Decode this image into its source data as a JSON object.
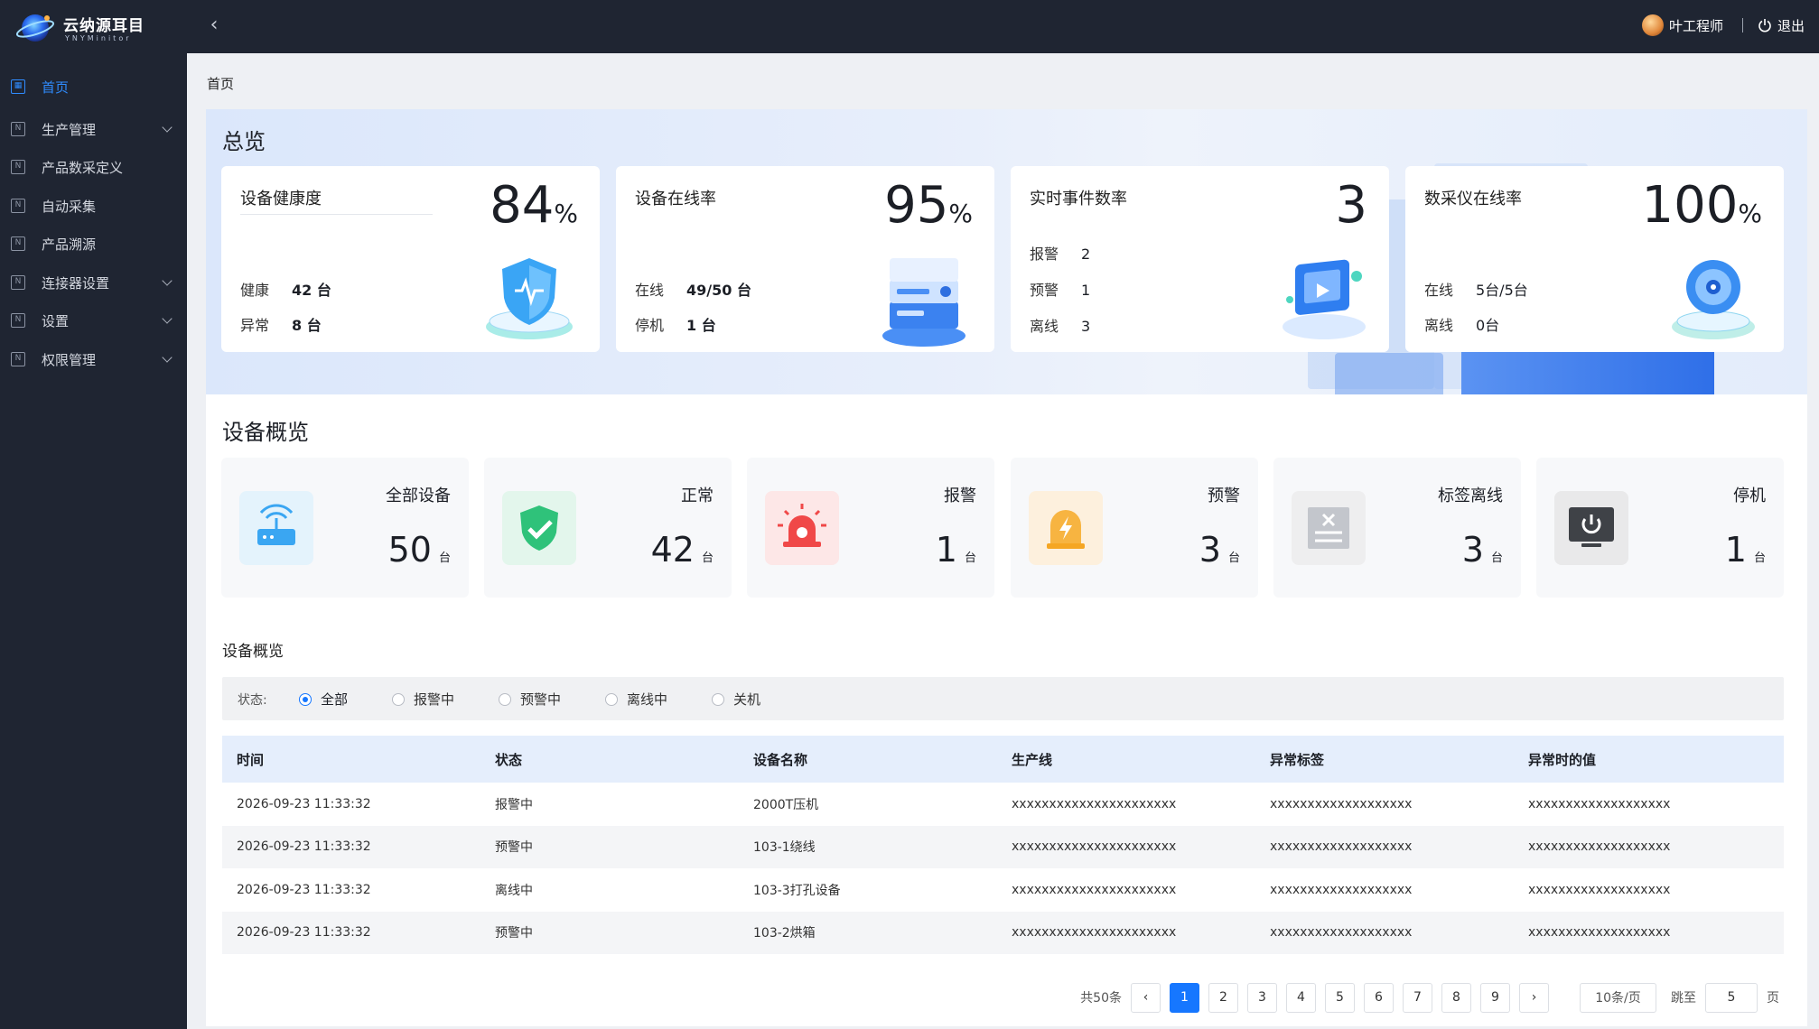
{
  "app": {
    "title": "云纳源耳目",
    "subtitle": "YNYMinitor"
  },
  "header": {
    "user_name": "叶工程师",
    "logout_label": "退出"
  },
  "sidebar": {
    "items": [
      {
        "label": "首页",
        "active": true,
        "has_children": false
      },
      {
        "label": "生产管理",
        "active": false,
        "has_children": true
      },
      {
        "label": "产品数采定义",
        "active": false,
        "has_children": false
      },
      {
        "label": "自动采集",
        "active": false,
        "has_children": false
      },
      {
        "label": "产品溯源",
        "active": false,
        "has_children": false
      },
      {
        "label": "连接器设置",
        "active": false,
        "has_children": true
      },
      {
        "label": "设置",
        "active": false,
        "has_children": true
      },
      {
        "label": "权限管理",
        "active": false,
        "has_children": true
      }
    ]
  },
  "breadcrumb": "首页",
  "overview": {
    "title": "总览",
    "cards": [
      {
        "title": "设备健康度",
        "value": "84",
        "unit": "%",
        "rows": [
          {
            "k": "健康",
            "v": "42 台"
          },
          {
            "k": "异常",
            "v": "8 台"
          }
        ],
        "icon": "shield-icon"
      },
      {
        "title": "设备在线率",
        "value": "95",
        "unit": "%",
        "rows": [
          {
            "k": "在线",
            "v": "49/50 台"
          },
          {
            "k": "停机",
            "v": "1 台"
          }
        ],
        "icon": "server-icon"
      },
      {
        "title": "实时事件数率",
        "value": "3",
        "unit": "",
        "rows": [
          {
            "k": "报警",
            "v": "2"
          },
          {
            "k": "预警",
            "v": "1"
          },
          {
            "k": "离线",
            "v": "3"
          }
        ],
        "icon": "video-icon"
      },
      {
        "title": "数采仪在线率",
        "value": "100",
        "unit": "%",
        "rows": [
          {
            "k": "在线",
            "v": "5台/5台"
          },
          {
            "k": "离线",
            "v": "0台"
          }
        ],
        "icon": "disc-icon"
      }
    ]
  },
  "device_overview": {
    "title": "设备概览",
    "cards": [
      {
        "label": "全部设备",
        "value": "50",
        "unit": "台",
        "icon": "router-icon"
      },
      {
        "label": "正常",
        "value": "42",
        "unit": "台",
        "icon": "check-shield-icon"
      },
      {
        "label": "报警",
        "value": "1",
        "unit": "台",
        "icon": "siren-icon"
      },
      {
        "label": "预警",
        "value": "3",
        "unit": "台",
        "icon": "warning-lamp-icon"
      },
      {
        "label": "标签离线",
        "value": "3",
        "unit": "台",
        "icon": "tag-offline-icon"
      },
      {
        "label": "停机",
        "value": "1",
        "unit": "台",
        "icon": "power-icon"
      }
    ]
  },
  "table_section": {
    "title": "设备概览",
    "filter_label": "状态:",
    "filters": [
      "全部",
      "报警中",
      "预警中",
      "离线中",
      "关机"
    ],
    "selected_filter": "全部",
    "columns": [
      "时间",
      "状态",
      "设备名称",
      "生产线",
      "异常标签",
      "异常时的值"
    ],
    "rows": [
      {
        "time": "2026-09-23  11:33:32",
        "status": "报警中",
        "status_type": "alarm",
        "device": "2000T压机",
        "line": "xxxxxxxxxxxxxxxxxxxxxx",
        "tag": "xxxxxxxxxxxxxxxxxxx",
        "value": "xxxxxxxxxxxxxxxxxxx"
      },
      {
        "time": "2026-09-23  11:33:32",
        "status": "预警中",
        "status_type": "warn",
        "device": "103-1绕线",
        "line": "xxxxxxxxxxxxxxxxxxxxxx",
        "tag": "xxxxxxxxxxxxxxxxxxx",
        "value": "xxxxxxxxxxxxxxxxxxx"
      },
      {
        "time": "2026-09-23  11:33:32",
        "status": "离线中",
        "status_type": "off",
        "device": "103-3打孔设备",
        "line": "xxxxxxxxxxxxxxxxxxxxxx",
        "tag": "xxxxxxxxxxxxxxxxxxx",
        "value": "xxxxxxxxxxxxxxxxxxx"
      },
      {
        "time": "2026-09-23  11:33:32",
        "status": "预警中",
        "status_type": "warn",
        "device": "103-2烘箱",
        "line": "xxxxxxxxxxxxxxxxxxxxxx",
        "tag": "xxxxxxxxxxxxxxxxxxx",
        "value": "xxxxxxxxxxxxxxxxxxx"
      }
    ]
  },
  "pagination": {
    "total_label": "共50条",
    "pages": [
      "1",
      "2",
      "3",
      "4",
      "5",
      "6",
      "7",
      "8",
      "9"
    ],
    "current": "1",
    "page_size": "10条/页",
    "jump_label": "跳至",
    "jump_value": "5",
    "page_suffix": "页"
  },
  "colors": {
    "accent": "#1677ff",
    "alarm": "#f5222d",
    "warn": "#faad14",
    "sidebar_bg": "#1f2532"
  }
}
